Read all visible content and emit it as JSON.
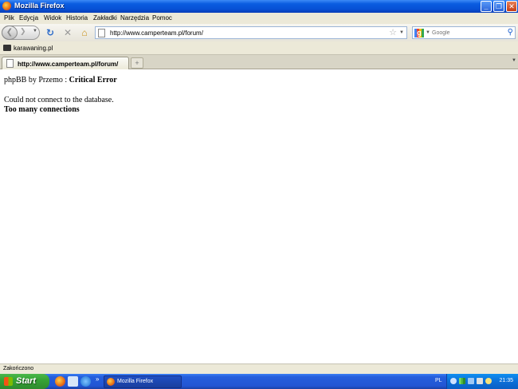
{
  "window": {
    "title": "Mozilla Firefox"
  },
  "menu": {
    "items": [
      "Plik",
      "Edycja",
      "Widok",
      "Historia",
      "Zakładki",
      "Narzędzia",
      "Pomoc"
    ]
  },
  "nav": {
    "url": "http://www.camperteam.pl/forum/",
    "search_placeholder": "Google"
  },
  "bookmarks": {
    "items": [
      "karawaning.pl"
    ]
  },
  "tabs": {
    "items": [
      {
        "label": "http://www.camperteam.pl/forum/"
      }
    ]
  },
  "page": {
    "line1_prefix": "phpBB by Przemo : ",
    "line1_bold": "Critical Error",
    "line2": "Could not connect to the database.",
    "line3": "Too many connections"
  },
  "status": {
    "text": "Zakończono"
  },
  "taskbar": {
    "start_label": "Start",
    "quicklaunch_more": "»",
    "buttons": [
      {
        "label": "Mozilla Firefox"
      }
    ],
    "language": "PL",
    "clock": "21:35"
  },
  "colors": {
    "titlebar": "#0751d6",
    "taskbar": "#245edc",
    "start": "#36a336"
  }
}
